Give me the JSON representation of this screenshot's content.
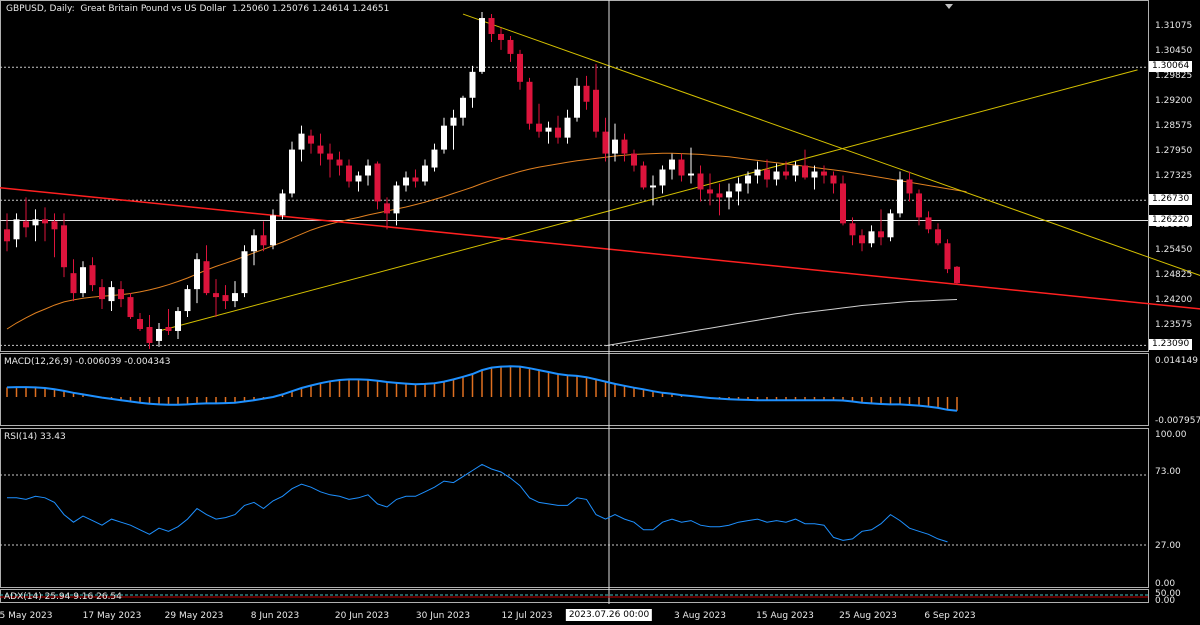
{
  "header": {
    "symbol": "GBPUSD, Daily:",
    "description": "Great Britain Pound vs US Dollar",
    "ohlc": "1.25060 1.25076 1.24614 1.24651"
  },
  "price_axis": {
    "ticks": [
      "1.31075",
      "1.30450",
      "1.29825",
      "1.29200",
      "1.28575",
      "1.27950",
      "1.27325",
      "1.26700",
      "1.26075",
      "1.25450",
      "1.24825",
      "1.24200",
      "1.23575"
    ],
    "boxes": [
      "1.30064",
      "1.26730",
      "1.26220",
      "1.23090"
    ]
  },
  "macd": {
    "label": "MACD(12,26,9) -0.006039 -0.004343",
    "top_tick": "0.014149",
    "bottom_tick": "-0.007957"
  },
  "rsi": {
    "label": "RSI(14) 33.43",
    "ticks": [
      "100.00",
      "73.00",
      "27.00",
      "0.00"
    ]
  },
  "adx": {
    "label": "ADX(14) 25.94 9.16 26.54",
    "ticks": [
      "50.00",
      "0.00"
    ]
  },
  "time_axis": {
    "labels": [
      "5 May 2023",
      "17 May 2023",
      "29 May 2023",
      "8 Jun 2023",
      "20 Jun 2023",
      "30 Jun 2023",
      "12 Jul 2023",
      "3 Aug 2023",
      "15 Aug 2023",
      "25 Aug 2023",
      "6 Sep 2023"
    ],
    "crosshair_time": "2023.07.26 00:00"
  },
  "colors": {
    "bull": "#ffffff",
    "bear": "#dc143c",
    "grid": "#c8c8c8",
    "trend_red": "#ff2020",
    "trend_yellow": "#d4c000",
    "ma_orange": "#e08020",
    "ma_white": "#d0d0d0",
    "indicator_blue": "#1e90ff",
    "histogram": "#e07020"
  },
  "chart_data": {
    "type": "candlestick",
    "candles": [
      {
        "o": 1.26,
        "h": 1.264,
        "l": 1.2545,
        "c": 1.257
      },
      {
        "o": 1.2575,
        "h": 1.264,
        "l": 1.2555,
        "c": 1.2625
      },
      {
        "o": 1.262,
        "h": 1.268,
        "l": 1.258,
        "c": 1.2605
      },
      {
        "o": 1.261,
        "h": 1.265,
        "l": 1.257,
        "c": 1.2625
      },
      {
        "o": 1.2625,
        "h": 1.2655,
        "l": 1.257,
        "c": 1.2615
      },
      {
        "o": 1.262,
        "h": 1.264,
        "l": 1.253,
        "c": 1.26
      },
      {
        "o": 1.261,
        "h": 1.264,
        "l": 1.248,
        "c": 1.2505
      },
      {
        "o": 1.249,
        "h": 1.2525,
        "l": 1.242,
        "c": 1.244
      },
      {
        "o": 1.244,
        "h": 1.252,
        "l": 1.243,
        "c": 1.2505
      },
      {
        "o": 1.251,
        "h": 1.253,
        "l": 1.2445,
        "c": 1.246
      },
      {
        "o": 1.2455,
        "h": 1.2475,
        "l": 1.24,
        "c": 1.2425
      },
      {
        "o": 1.242,
        "h": 1.247,
        "l": 1.2395,
        "c": 1.2455
      },
      {
        "o": 1.245,
        "h": 1.247,
        "l": 1.2405,
        "c": 1.2425
      },
      {
        "o": 1.243,
        "h": 1.244,
        "l": 1.2375,
        "c": 1.238
      },
      {
        "o": 1.2375,
        "h": 1.239,
        "l": 1.2345,
        "c": 1.235
      },
      {
        "o": 1.2355,
        "h": 1.2385,
        "l": 1.23,
        "c": 1.2315
      },
      {
        "o": 1.232,
        "h": 1.2365,
        "l": 1.2305,
        "c": 1.235
      },
      {
        "o": 1.2355,
        "h": 1.24,
        "l": 1.2335,
        "c": 1.2345
      },
      {
        "o": 1.2345,
        "h": 1.2405,
        "l": 1.2325,
        "c": 1.2395
      },
      {
        "o": 1.2395,
        "h": 1.246,
        "l": 1.238,
        "c": 1.245
      },
      {
        "o": 1.245,
        "h": 1.254,
        "l": 1.2415,
        "c": 1.2525
      },
      {
        "o": 1.252,
        "h": 1.256,
        "l": 1.2435,
        "c": 1.244
      },
      {
        "o": 1.244,
        "h": 1.2475,
        "l": 1.238,
        "c": 1.243
      },
      {
        "o": 1.2435,
        "h": 1.246,
        "l": 1.24,
        "c": 1.242
      },
      {
        "o": 1.242,
        "h": 1.247,
        "l": 1.2405,
        "c": 1.244
      },
      {
        "o": 1.244,
        "h": 1.256,
        "l": 1.243,
        "c": 1.2545
      },
      {
        "o": 1.2545,
        "h": 1.26,
        "l": 1.251,
        "c": 1.2585
      },
      {
        "o": 1.2585,
        "h": 1.262,
        "l": 1.2545,
        "c": 1.256
      },
      {
        "o": 1.256,
        "h": 1.265,
        "l": 1.255,
        "c": 1.2635
      },
      {
        "o": 1.2635,
        "h": 1.27,
        "l": 1.2625,
        "c": 1.269
      },
      {
        "o": 1.269,
        "h": 1.282,
        "l": 1.268,
        "c": 1.28
      },
      {
        "o": 1.28,
        "h": 1.286,
        "l": 1.277,
        "c": 1.284
      },
      {
        "o": 1.2835,
        "h": 1.285,
        "l": 1.279,
        "c": 1.2815
      },
      {
        "o": 1.281,
        "h": 1.284,
        "l": 1.276,
        "c": 1.279
      },
      {
        "o": 1.279,
        "h": 1.2815,
        "l": 1.273,
        "c": 1.2775
      },
      {
        "o": 1.2775,
        "h": 1.2795,
        "l": 1.2735,
        "c": 1.276
      },
      {
        "o": 1.276,
        "h": 1.2775,
        "l": 1.2705,
        "c": 1.272
      },
      {
        "o": 1.272,
        "h": 1.2745,
        "l": 1.2695,
        "c": 1.2735
      },
      {
        "o": 1.2735,
        "h": 1.2775,
        "l": 1.271,
        "c": 1.276
      },
      {
        "o": 1.2765,
        "h": 1.277,
        "l": 1.265,
        "c": 1.267
      },
      {
        "o": 1.2665,
        "h": 1.268,
        "l": 1.26,
        "c": 1.264
      },
      {
        "o": 1.264,
        "h": 1.272,
        "l": 1.261,
        "c": 1.271
      },
      {
        "o": 1.271,
        "h": 1.2745,
        "l": 1.2695,
        "c": 1.273
      },
      {
        "o": 1.273,
        "h": 1.275,
        "l": 1.2705,
        "c": 1.272
      },
      {
        "o": 1.272,
        "h": 1.2775,
        "l": 1.271,
        "c": 1.276
      },
      {
        "o": 1.2755,
        "h": 1.2815,
        "l": 1.2745,
        "c": 1.28
      },
      {
        "o": 1.28,
        "h": 1.288,
        "l": 1.279,
        "c": 1.286
      },
      {
        "o": 1.286,
        "h": 1.29,
        "l": 1.28,
        "c": 1.288
      },
      {
        "o": 1.288,
        "h": 1.2935,
        "l": 1.286,
        "c": 1.293
      },
      {
        "o": 1.293,
        "h": 1.301,
        "l": 1.2905,
        "c": 1.2995
      },
      {
        "o": 1.2995,
        "h": 1.3145,
        "l": 1.299,
        "c": 1.313
      },
      {
        "o": 1.313,
        "h": 1.314,
        "l": 1.307,
        "c": 1.309
      },
      {
        "o": 1.309,
        "h": 1.3105,
        "l": 1.305,
        "c": 1.3075
      },
      {
        "o": 1.3075,
        "h": 1.3085,
        "l": 1.302,
        "c": 1.304
      },
      {
        "o": 1.304,
        "h": 1.305,
        "l": 1.295,
        "c": 1.297
      },
      {
        "o": 1.297,
        "h": 1.298,
        "l": 1.285,
        "c": 1.2865
      },
      {
        "o": 1.2865,
        "h": 1.2915,
        "l": 1.283,
        "c": 1.2845
      },
      {
        "o": 1.2845,
        "h": 1.287,
        "l": 1.2815,
        "c": 1.2855
      },
      {
        "o": 1.2855,
        "h": 1.2885,
        "l": 1.2815,
        "c": 1.283
      },
      {
        "o": 1.283,
        "h": 1.29,
        "l": 1.2815,
        "c": 1.288
      },
      {
        "o": 1.288,
        "h": 1.298,
        "l": 1.287,
        "c": 1.296
      },
      {
        "o": 1.296,
        "h": 1.2985,
        "l": 1.29,
        "c": 1.292
      },
      {
        "o": 1.295,
        "h": 1.3015,
        "l": 1.283,
        "c": 1.2845
      },
      {
        "o": 1.2845,
        "h": 1.288,
        "l": 1.277,
        "c": 1.279
      },
      {
        "o": 1.279,
        "h": 1.2865,
        "l": 1.277,
        "c": 1.2825
      },
      {
        "o": 1.2825,
        "h": 1.284,
        "l": 1.277,
        "c": 1.279
      },
      {
        "o": 1.279,
        "h": 1.28,
        "l": 1.2745,
        "c": 1.276
      },
      {
        "o": 1.276,
        "h": 1.277,
        "l": 1.27,
        "c": 1.2705
      },
      {
        "o": 1.2705,
        "h": 1.2735,
        "l": 1.266,
        "c": 1.271
      },
      {
        "o": 1.271,
        "h": 1.276,
        "l": 1.269,
        "c": 1.275
      },
      {
        "o": 1.275,
        "h": 1.279,
        "l": 1.2725,
        "c": 1.2775
      },
      {
        "o": 1.2775,
        "h": 1.279,
        "l": 1.272,
        "c": 1.2735
      },
      {
        "o": 1.2735,
        "h": 1.2805,
        "l": 1.2715,
        "c": 1.274
      },
      {
        "o": 1.274,
        "h": 1.276,
        "l": 1.267,
        "c": 1.27
      },
      {
        "o": 1.27,
        "h": 1.274,
        "l": 1.266,
        "c": 1.269
      },
      {
        "o": 1.269,
        "h": 1.2715,
        "l": 1.2635,
        "c": 1.268
      },
      {
        "o": 1.268,
        "h": 1.2715,
        "l": 1.265,
        "c": 1.2695
      },
      {
        "o": 1.2695,
        "h": 1.273,
        "l": 1.266,
        "c": 1.2715
      },
      {
        "o": 1.2715,
        "h": 1.2745,
        "l": 1.269,
        "c": 1.2735
      },
      {
        "o": 1.2735,
        "h": 1.277,
        "l": 1.2715,
        "c": 1.275
      },
      {
        "o": 1.275,
        "h": 1.2775,
        "l": 1.2705,
        "c": 1.2725
      },
      {
        "o": 1.2725,
        "h": 1.2765,
        "l": 1.271,
        "c": 1.2745
      },
      {
        "o": 1.2745,
        "h": 1.277,
        "l": 1.2725,
        "c": 1.2735
      },
      {
        "o": 1.2735,
        "h": 1.277,
        "l": 1.272,
        "c": 1.276
      },
      {
        "o": 1.276,
        "h": 1.28,
        "l": 1.2725,
        "c": 1.273
      },
      {
        "o": 1.273,
        "h": 1.276,
        "l": 1.27,
        "c": 1.2745
      },
      {
        "o": 1.2745,
        "h": 1.276,
        "l": 1.2715,
        "c": 1.2735
      },
      {
        "o": 1.2735,
        "h": 1.2745,
        "l": 1.269,
        "c": 1.2715
      },
      {
        "o": 1.2715,
        "h": 1.2735,
        "l": 1.261,
        "c": 1.2615
      },
      {
        "o": 1.2615,
        "h": 1.263,
        "l": 1.256,
        "c": 1.2585
      },
      {
        "o": 1.2585,
        "h": 1.26,
        "l": 1.2545,
        "c": 1.2565
      },
      {
        "o": 1.2565,
        "h": 1.261,
        "l": 1.2555,
        "c": 1.2595
      },
      {
        "o": 1.2595,
        "h": 1.265,
        "l": 1.256,
        "c": 1.258
      },
      {
        "o": 1.258,
        "h": 1.265,
        "l": 1.257,
        "c": 1.264
      },
      {
        "o": 1.264,
        "h": 1.2745,
        "l": 1.263,
        "c": 1.2725
      },
      {
        "o": 1.2725,
        "h": 1.2745,
        "l": 1.267,
        "c": 1.269
      },
      {
        "o": 1.269,
        "h": 1.27,
        "l": 1.261,
        "c": 1.263
      },
      {
        "o": 1.263,
        "h": 1.2645,
        "l": 1.259,
        "c": 1.26
      },
      {
        "o": 1.26,
        "h": 1.2615,
        "l": 1.256,
        "c": 1.2565
      },
      {
        "o": 1.2565,
        "h": 1.2575,
        "l": 1.249,
        "c": 1.25
      },
      {
        "o": 1.2506,
        "h": 1.2508,
        "l": 1.2461,
        "c": 1.2465
      }
    ],
    "ma_orange": [
      1.235,
      1.2365,
      1.2378,
      1.239,
      1.24,
      1.241,
      1.2418,
      1.2423,
      1.2427,
      1.243,
      1.2432,
      1.2434,
      1.2436,
      1.2439,
      1.2443,
      1.2448,
      1.2454,
      1.2461,
      1.2469,
      1.2478,
      1.2488,
      1.2498,
      1.2507,
      1.2515,
      1.2523,
      1.2532,
      1.2541,
      1.255,
      1.2559,
      1.2568,
      1.2578,
      1.2588,
      1.2598,
      1.2606,
      1.2613,
      1.2619,
      1.2625,
      1.263,
      1.2636,
      1.2641,
      1.2646,
      1.2651,
      1.2656,
      1.2662,
      1.2668,
      1.2675,
      1.2682,
      1.269,
      1.2698,
      1.2706,
      1.2715,
      1.2723,
      1.2731,
      1.2738,
      1.2745,
      1.2751,
      1.2756,
      1.276,
      1.2764,
      1.2768,
      1.2772,
      1.2775,
      1.2778,
      1.2781,
      1.2784,
      1.2786,
      1.2788,
      1.2789,
      1.279,
      1.2791,
      1.2791,
      1.279,
      1.2789,
      1.2788,
      1.2786,
      1.2784,
      1.2782,
      1.2779,
      1.2776,
      1.2773,
      1.277,
      1.2767,
      1.2764,
      1.2761,
      1.2758,
      1.2755,
      1.2752,
      1.2749,
      1.2746,
      1.2742,
      1.2738,
      1.2734,
      1.273,
      1.2726,
      1.2722,
      1.2718,
      1.2714,
      1.271,
      1.2706,
      1.2702,
      1.2698,
      1.2694
    ],
    "ma_white_start_index": 63,
    "ma_white": [
      1.2308,
      1.2312,
      1.2316,
      1.232,
      1.2324,
      1.2328,
      1.2332,
      1.2336,
      1.234,
      1.2344,
      1.2348,
      1.2352,
      1.2356,
      1.236,
      1.2364,
      1.2368,
      1.2372,
      1.2376,
      1.238,
      1.2384,
      1.2388,
      1.2391,
      1.2394,
      1.2397,
      1.24,
      1.2403,
      1.2406,
      1.2409,
      1.2411,
      1.2413,
      1.2415,
      1.2417,
      1.2419,
      1.242,
      1.2421,
      1.2422,
      1.2423,
      1.2424
    ],
    "trendlines": [
      {
        "name": "red-support",
        "from": {
          "index": -1,
          "price": 1.2705
        },
        "to": {
          "index": 132,
          "price": 1.2385
        }
      },
      {
        "name": "yellow-resistance",
        "from": {
          "index": 48,
          "price": 1.314
        },
        "to": {
          "index": 132,
          "price": 1.243
        }
      },
      {
        "name": "yellow-channel",
        "from": {
          "index": 16,
          "price": 1.2345
        },
        "to": {
          "index": 119,
          "price": 1.3
        }
      }
    ],
    "macd_hist": [
      0.003,
      0.0031,
      0.0031,
      0.003,
      0.0028,
      0.0024,
      0.0019,
      0.0013,
      0.0008,
      0.0003,
      -0.0002,
      -0.0006,
      -0.001,
      -0.0014,
      -0.0018,
      -0.0021,
      -0.0023,
      -0.0024,
      -0.0024,
      -0.0023,
      -0.0021,
      -0.002,
      -0.002,
      -0.0019,
      -0.0018,
      -0.0014,
      -0.001,
      -0.0005,
      0.0,
      0.0008,
      0.0018,
      0.0028,
      0.0036,
      0.0043,
      0.0049,
      0.0053,
      0.0055,
      0.0055,
      0.0054,
      0.0051,
      0.0047,
      0.0044,
      0.0042,
      0.004,
      0.0041,
      0.0043,
      0.0048,
      0.0055,
      0.0063,
      0.0072,
      0.0084,
      0.0092,
      0.0095,
      0.0096,
      0.0095,
      0.009,
      0.0084,
      0.0078,
      0.0072,
      0.0068,
      0.0066,
      0.0062,
      0.0055,
      0.0048,
      0.0041,
      0.0035,
      0.0029,
      0.0024,
      0.0018,
      0.0013,
      0.001,
      0.0006,
      0.0003,
      0.0,
      -0.0003,
      -0.0005,
      -0.0007,
      -0.0008,
      -0.0009,
      -0.001,
      -0.001,
      -0.001,
      -0.001,
      -0.001,
      -0.001,
      -0.001,
      -0.001,
      -0.001,
      -0.0011,
      -0.0014,
      -0.0018,
      -0.002,
      -0.0022,
      -0.0023,
      -0.0023,
      -0.0025,
      -0.0027,
      -0.003,
      -0.0034,
      -0.004,
      -0.0043
    ],
    "macd_signal": [
      0.003,
      0.0031,
      0.0031,
      0.003,
      0.0028,
      0.0024,
      0.0019,
      0.0013,
      0.0008,
      0.0003,
      -0.0002,
      -0.0006,
      -0.001,
      -0.0014,
      -0.0018,
      -0.0021,
      -0.0023,
      -0.0024,
      -0.0024,
      -0.0023,
      -0.0021,
      -0.002,
      -0.002,
      -0.0019,
      -0.0018,
      -0.0014,
      -0.001,
      -0.0005,
      0.0,
      0.0008,
      0.0018,
      0.0028,
      0.0036,
      0.0043,
      0.0049,
      0.0053,
      0.0055,
      0.0055,
      0.0054,
      0.0051,
      0.0047,
      0.0044,
      0.0042,
      0.004,
      0.0041,
      0.0043,
      0.0048,
      0.0055,
      0.0063,
      0.0072,
      0.0084,
      0.0092,
      0.0095,
      0.0096,
      0.0095,
      0.009,
      0.0084,
      0.0078,
      0.0072,
      0.0068,
      0.0066,
      0.0062,
      0.0055,
      0.0048,
      0.0041,
      0.0035,
      0.0029,
      0.0024,
      0.0018,
      0.0013,
      0.001,
      0.0006,
      0.0003,
      0.0,
      -0.0003,
      -0.0005,
      -0.0007,
      -0.0008,
      -0.0009,
      -0.001,
      -0.001,
      -0.001,
      -0.001,
      -0.001,
      -0.001,
      -0.001,
      -0.001,
      -0.001,
      -0.0011,
      -0.0014,
      -0.0018,
      -0.002,
      -0.0022,
      -0.0023,
      -0.0023,
      -0.0025,
      -0.0027,
      -0.003,
      -0.0034,
      -0.004,
      -0.0043
    ],
    "rsi": [
      58,
      58,
      57,
      59,
      58,
      55,
      47,
      42,
      46,
      43,
      40,
      44,
      42,
      40,
      37,
      34,
      38,
      36,
      39,
      44,
      51,
      47,
      44,
      45,
      47,
      53,
      55,
      51,
      56,
      59,
      64,
      67,
      65,
      62,
      60,
      59,
      57,
      58,
      60,
      54,
      52,
      57,
      59,
      59,
      62,
      65,
      69,
      68,
      72,
      76,
      80,
      77,
      75,
      71,
      66,
      58,
      55,
      54,
      53,
      53,
      58,
      57,
      47,
      44,
      47,
      44,
      42,
      37,
      37,
      42,
      44,
      42,
      43,
      40,
      39,
      39,
      40,
      42,
      43,
      44,
      42,
      43,
      42,
      44,
      41,
      41,
      40,
      32,
      30,
      31,
      36,
      37,
      41,
      47,
      43,
      38,
      36,
      34,
      31,
      29
    ]
  }
}
